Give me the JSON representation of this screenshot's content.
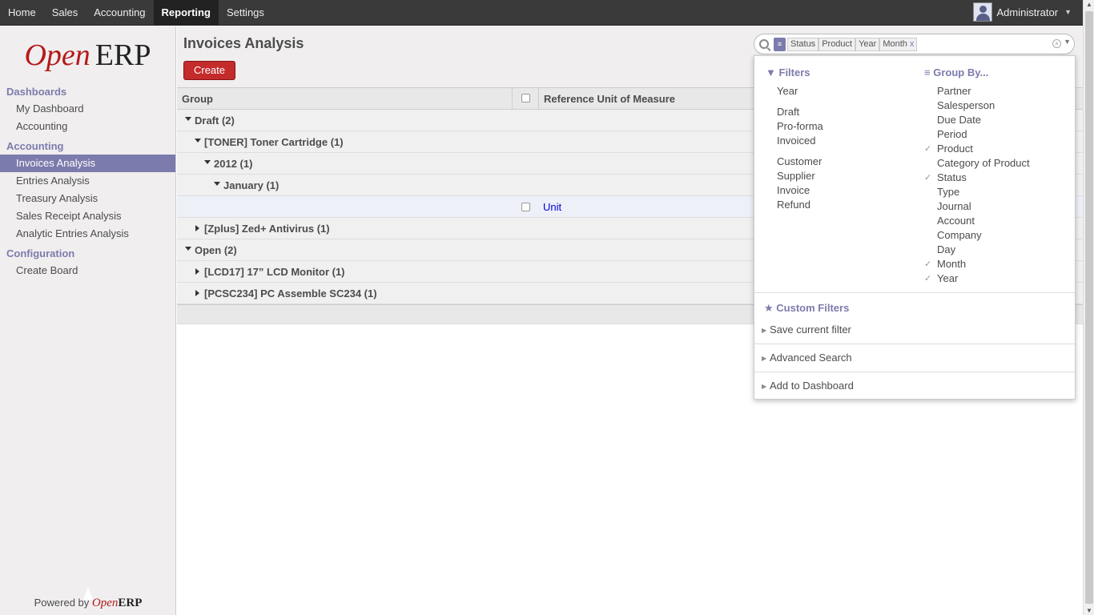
{
  "topbar": {
    "menus": [
      "Home",
      "Sales",
      "Accounting",
      "Reporting",
      "Settings"
    ],
    "active": "Reporting",
    "user": "Administrator"
  },
  "logo": {
    "open": "Open",
    "erp": "ERP"
  },
  "sidebar": {
    "sections": [
      {
        "title": "Dashboards",
        "items": [
          "My Dashboard",
          "Accounting"
        ]
      },
      {
        "title": "Accounting",
        "items": [
          "Invoices Analysis",
          "Entries Analysis",
          "Treasury Analysis",
          "Sales Receipt Analysis",
          "Analytic Entries Analysis"
        ]
      },
      {
        "title": "Configuration",
        "items": [
          "Create Board"
        ]
      }
    ],
    "active_item": "Invoices Analysis",
    "powered_by": "Powered by",
    "powered_open": "Open",
    "powered_erp": "ERP"
  },
  "header": {
    "title": "Invoices Analysis",
    "create_label": "Create"
  },
  "search": {
    "facets": [
      "Status",
      "Product",
      "Year",
      "Month"
    ],
    "facet_remove": "x"
  },
  "table": {
    "col_group": "Group",
    "col_uom": "Reference Unit of Measure",
    "rows": [
      {
        "label": "Draft (2)",
        "level": 0,
        "state": "open"
      },
      {
        "label": "[TONER] Toner Cartridge (1)",
        "level": 1,
        "state": "open"
      },
      {
        "label": "2012 (1)",
        "level": 2,
        "state": "open"
      },
      {
        "label": "January (1)",
        "level": 3,
        "state": "open"
      },
      {
        "label": "",
        "level": 4,
        "state": "record",
        "uom": "Unit"
      },
      {
        "label": "[Zplus] Zed+ Antivirus (1)",
        "level": 1,
        "state": "closed"
      },
      {
        "label": "Open (2)",
        "level": 0,
        "state": "open"
      },
      {
        "label": "[LCD17] 17” LCD Monitor (1)",
        "level": 1,
        "state": "closed"
      },
      {
        "label": "[PCSC234] PC Assemble SC234 (1)",
        "level": 1,
        "state": "closed"
      }
    ]
  },
  "dropdown": {
    "filters_title": "Filters",
    "filters": [
      [
        "Year"
      ],
      [
        "Draft",
        "Pro-forma",
        "Invoiced"
      ],
      [
        "Customer",
        "Supplier",
        "Invoice",
        "Refund"
      ]
    ],
    "groupby_title": "Group By...",
    "groupby": [
      {
        "label": "Partner",
        "checked": false
      },
      {
        "label": "Salesperson",
        "checked": false
      },
      {
        "label": "Due Date",
        "checked": false
      },
      {
        "label": "Period",
        "checked": false
      },
      {
        "label": "Product",
        "checked": true
      },
      {
        "label": "Category of Product",
        "checked": false
      },
      {
        "label": "Status",
        "checked": true
      },
      {
        "label": "Type",
        "checked": false
      },
      {
        "label": "Journal",
        "checked": false
      },
      {
        "label": "Account",
        "checked": false
      },
      {
        "label": "Company",
        "checked": false
      },
      {
        "label": "Day",
        "checked": false
      },
      {
        "label": "Month",
        "checked": true
      },
      {
        "label": "Year",
        "checked": true
      }
    ],
    "custom_title": "Custom Filters",
    "save_filter": "Save current filter",
    "advanced_search": "Advanced Search",
    "add_dashboard": "Add to Dashboard"
  }
}
